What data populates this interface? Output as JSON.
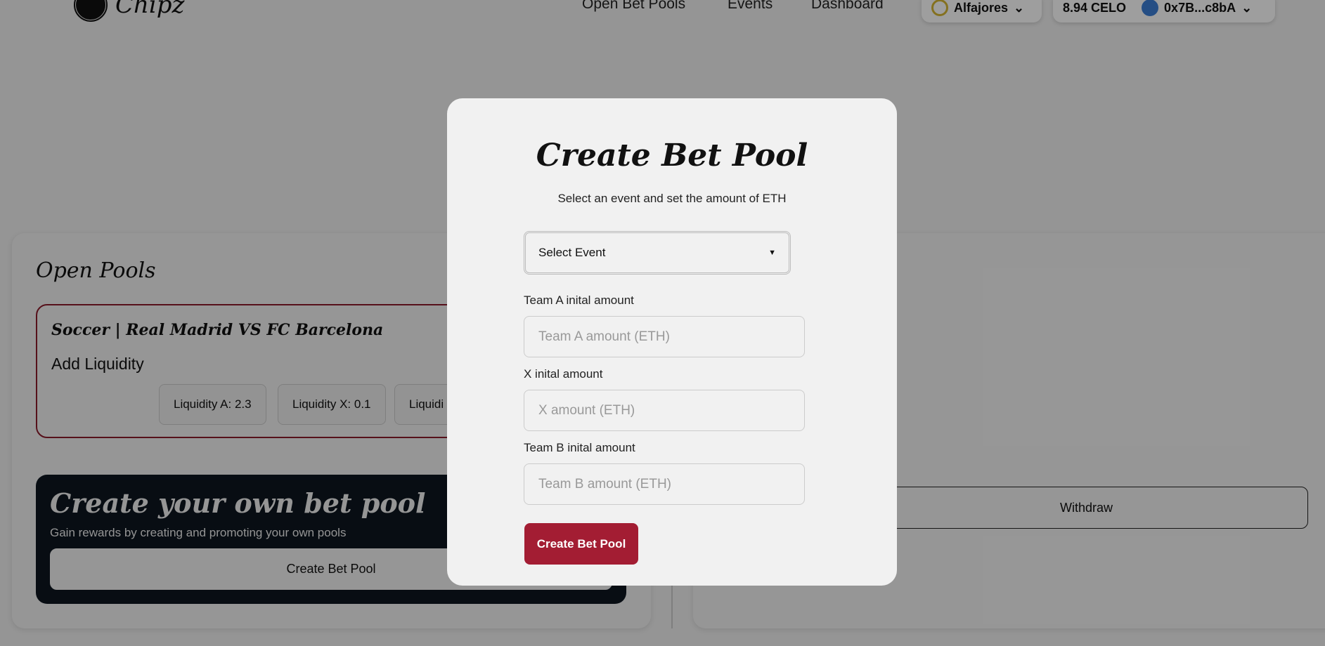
{
  "nav": {
    "brand": "Chipz",
    "links": [
      "Open Bet Pools",
      "Events",
      "Dashboard"
    ],
    "network": "Alfajores",
    "balance": "8.94 CELO",
    "account": "0x7B...c8bA"
  },
  "open_pools": {
    "title": "Open Pools",
    "pool": {
      "title": "Soccer | Real Madrid VS FC Barcelona",
      "subtitle": "Add Liquidity",
      "liquidity": [
        "Liquidity A: 2.3",
        "Liquidity X: 0.1",
        "Liquidi"
      ]
    }
  },
  "promo": {
    "title": "Create your own bet pool",
    "subtitle": "Gain rewards by creating and promoting your own pools",
    "button": "Create Bet Pool"
  },
  "right": {
    "withdraw": "Withdraw"
  },
  "modal": {
    "title": "Create Bet Pool",
    "subtitle": "Select an event and set the amount of ETH",
    "select": "Select Event",
    "fields": [
      {
        "label": "Team A inital amount",
        "placeholder": "Team A amount (ETH)"
      },
      {
        "label": "X inital amount",
        "placeholder": "X amount (ETH)"
      },
      {
        "label": "Team B inital amount",
        "placeholder": "Team B amount (ETH)"
      }
    ],
    "submit": "Create Bet Pool"
  },
  "colors": {
    "accent": "#a31d33",
    "dark": "#0d1620"
  }
}
